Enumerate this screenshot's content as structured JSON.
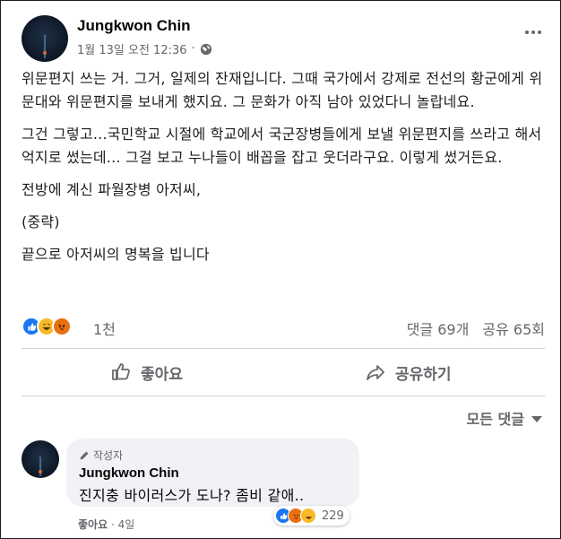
{
  "post": {
    "author": "Jungkwon Chin",
    "timestamp": "1월 13일 오전 12:36",
    "separator": "·",
    "privacy_icon": "globe-icon",
    "paragraphs": [
      "위문편지 쓰는 거. 그거, 일제의 잔재입니다. 그때 국가에서 강제로 전선의 황군에게 위문대와 위문편지를 보내게 했지요. 그 문화가 아직 남아 있었다니 놀랍네요.",
      "그건 그렇고...국민학교 시절에 학교에서 국군장병들에게 보낼 위문편지를 쓰라고 해서 억지로 썼는데... 그걸 보고 누나들이 배꼽을 잡고 웃더라구요. 이렇게 썼거든요.",
      "전방에 계신 파월장병 아저씨,",
      "(중략)",
      "끝으로 아저씨의 명복을 빕니다"
    ]
  },
  "reactions": {
    "icons": [
      "like-icon",
      "haha-icon",
      "angry-icon"
    ],
    "count": "1천",
    "comments": "댓글 69개",
    "shares": "공유 65회"
  },
  "actions": {
    "like_label": "좋아요",
    "share_label": "공유하기"
  },
  "comments_section": {
    "sort_label": "모든 댓글"
  },
  "comment": {
    "badge": "작성자",
    "author": "Jungkwon Chin",
    "text": "진지충 바이러스가 도나? 좀비 같애..",
    "reaction_count": "229",
    "like_label": "좋아요",
    "separator": "·",
    "age": "4일"
  },
  "colors": {
    "like": "#1877f2",
    "haha": "#f7b928",
    "angry": "#e9710f",
    "muted_text": "#65676b",
    "comment_bg": "#f0f2f5"
  }
}
